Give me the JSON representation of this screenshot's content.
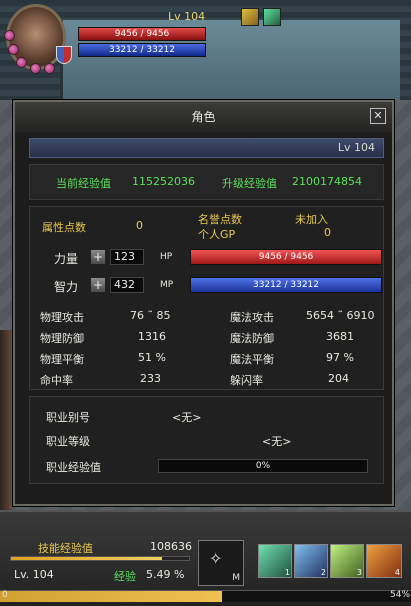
{
  "hud": {
    "level": "Lv 104",
    "hp": "9456 / 9456",
    "mp": "33212 / 33212"
  },
  "window": {
    "title": "角色",
    "close": "✕",
    "level": "Lv 104",
    "exp": {
      "current_label": "当前经验值",
      "current_value": "115252036",
      "next_label": "升级经验值",
      "next_value": "2100174854"
    },
    "attr": {
      "points_label": "属性点数",
      "points_value": "0",
      "fame_label": "名誉点数",
      "fame_value": "未加入",
      "gp_label": "个人GP",
      "gp_value": "0",
      "str_label": "力量",
      "str_value": "123",
      "hp_tag": "HP",
      "hp_bar": "9456 / 9456",
      "int_label": "智力",
      "int_value": "432",
      "mp_tag": "MP",
      "mp_bar": "33212 / 33212",
      "plus": "+"
    },
    "stats": [
      {
        "l1": "物理攻击",
        "v1": "76 ˜ 85",
        "l2": "魔法攻击",
        "v2": "5654 ˜ 6910"
      },
      {
        "l1": "物理防御",
        "v1": "1316",
        "l2": "魔法防御",
        "v2": "3681"
      },
      {
        "l1": "物理平衡",
        "v1": "51 %",
        "l2": "魔法平衡",
        "v2": "97 %"
      },
      {
        "l1": "命中率",
        "v1": "233",
        "l2": "躲闪率",
        "v2": "204"
      }
    ],
    "job": {
      "alias_label": "职业别号",
      "alias_value": "<无>",
      "level_label": "职业等级",
      "level_value": "<无>",
      "exp_label": "职业经验值",
      "exp_value": "0%"
    }
  },
  "bottom": {
    "skill_exp_label": "技能经验值",
    "skill_exp_value": "108636",
    "skill_exp_fill": 0.85,
    "level": "Lv.  104",
    "exp_label": "经验",
    "exp_value": "5.49 %",
    "exp_fill": 0.54,
    "exp_percent_right": "54%",
    "left_num": "0",
    "menu_key": "M",
    "slots": [
      "1",
      "2",
      "3",
      "4"
    ]
  }
}
